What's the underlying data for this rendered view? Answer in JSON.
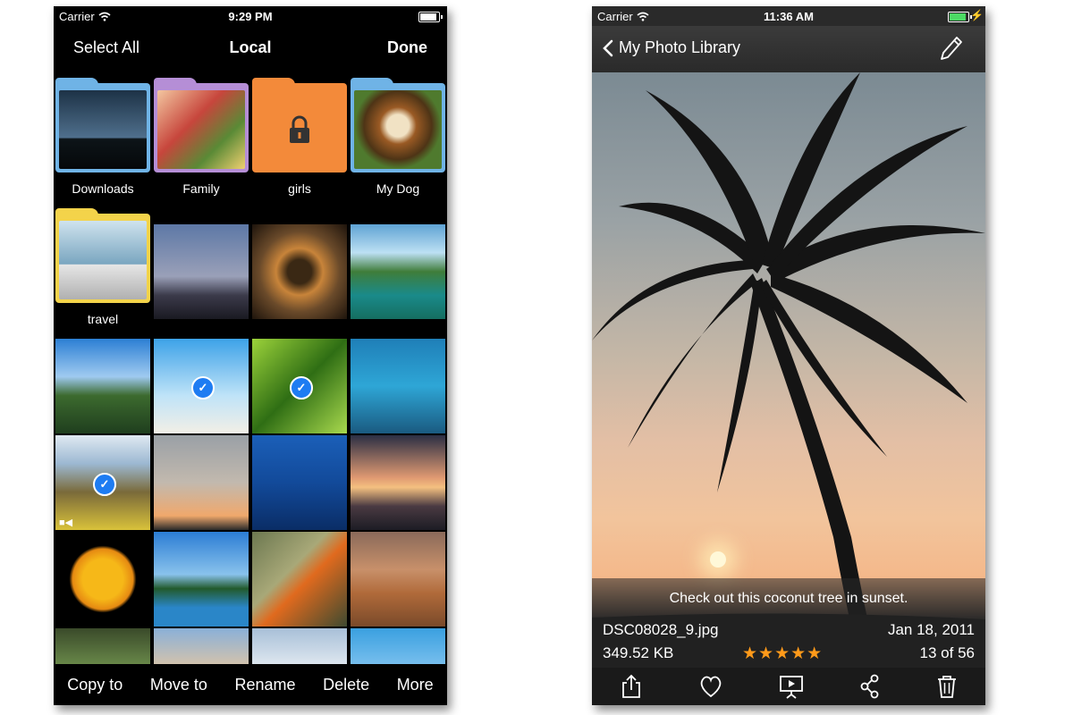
{
  "left_phone": {
    "status": {
      "carrier": "Carrier",
      "time": "9:29 PM"
    },
    "nav": {
      "left": "Select All",
      "title": "Local",
      "right": "Done"
    },
    "folders": [
      {
        "label": "Downloads",
        "color": "#6fb3e6"
      },
      {
        "label": "Family",
        "color": "#b58ed6"
      },
      {
        "label": "girls",
        "color": "#f38a3a",
        "locked": true
      },
      {
        "label": "My Dog",
        "color": "#6fb3e6"
      },
      {
        "label": "travel",
        "color": "#f3d34a"
      }
    ],
    "toolbar": {
      "copy": "Copy to",
      "move": "Move to",
      "rename": "Rename",
      "delete": "Delete",
      "more": "More"
    },
    "icons": {
      "check": "checkmark-icon",
      "lock": "lock-icon",
      "video": "video-camera-icon",
      "wifi": "wifi-icon"
    }
  },
  "right_phone": {
    "status": {
      "carrier": "Carrier",
      "time": "11:36 AM"
    },
    "nav": {
      "back": "My Photo Library"
    },
    "caption": "Check out this coconut tree in sunset.",
    "file": {
      "name": "DSC08028_9.jpg",
      "date": "Jan 18, 2011",
      "size": "349.52 KB",
      "rating": 5,
      "stars": "★★★★★",
      "position": "13 of 56"
    },
    "colors": {
      "star": "#ff9a1a",
      "battery": "#4cd964",
      "check": "#1e7cf2"
    }
  }
}
